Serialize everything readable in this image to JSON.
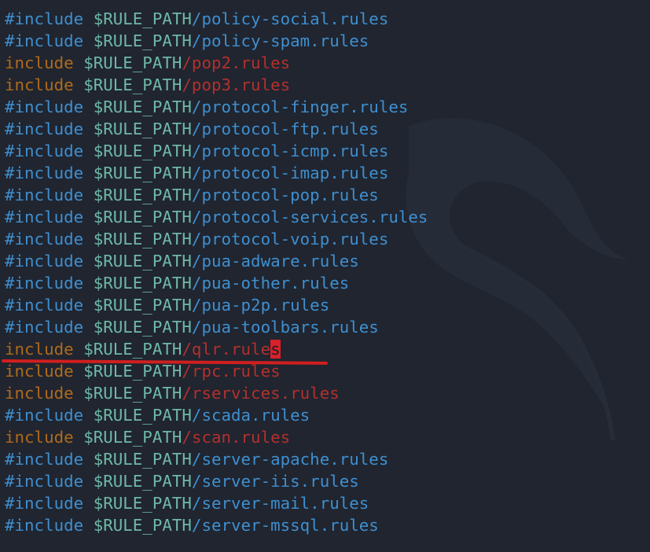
{
  "editor": {
    "lines": [
      {
        "prefix": "#include",
        "var": "$RULE_PATH",
        "path": "/policy-social.rules",
        "active": false
      },
      {
        "prefix": "#include",
        "var": "$RULE_PATH",
        "path": "/policy-spam.rules",
        "active": false
      },
      {
        "prefix": "include",
        "var": "$RULE_PATH",
        "path": "/pop2.rules",
        "active": true
      },
      {
        "prefix": "include",
        "var": "$RULE_PATH",
        "path": "/pop3.rules",
        "active": true
      },
      {
        "prefix": "#include",
        "var": "$RULE_PATH",
        "path": "/protocol-finger.rules",
        "active": false
      },
      {
        "prefix": "#include",
        "var": "$RULE_PATH",
        "path": "/protocol-ftp.rules",
        "active": false
      },
      {
        "prefix": "#include",
        "var": "$RULE_PATH",
        "path": "/protocol-icmp.rules",
        "active": false
      },
      {
        "prefix": "#include",
        "var": "$RULE_PATH",
        "path": "/protocol-imap.rules",
        "active": false
      },
      {
        "prefix": "#include",
        "var": "$RULE_PATH",
        "path": "/protocol-pop.rules",
        "active": false
      },
      {
        "prefix": "#include",
        "var": "$RULE_PATH",
        "path": "/protocol-services.rules",
        "active": false
      },
      {
        "prefix": "#include",
        "var": "$RULE_PATH",
        "path": "/protocol-voip.rules",
        "active": false
      },
      {
        "prefix": "#include",
        "var": "$RULE_PATH",
        "path": "/pua-adware.rules",
        "active": false
      },
      {
        "prefix": "#include",
        "var": "$RULE_PATH",
        "path": "/pua-other.rules",
        "active": false
      },
      {
        "prefix": "#include",
        "var": "$RULE_PATH",
        "path": "/pua-p2p.rules",
        "active": false
      },
      {
        "prefix": "#include",
        "var": "$RULE_PATH",
        "path": "/pua-toolbars.rules",
        "active": false
      },
      {
        "prefix": "include",
        "var": "$RULE_PATH",
        "path": "/qlr.rule",
        "cursor_char": "s",
        "active": true
      },
      {
        "prefix": "include",
        "var": "$RULE_PATH",
        "path": "/rpc.rules",
        "active": true
      },
      {
        "prefix": "include",
        "var": "$RULE_PATH",
        "path": "/rservices.rules",
        "active": true
      },
      {
        "prefix": "#include",
        "var": "$RULE_PATH",
        "path": "/scada.rules",
        "active": false
      },
      {
        "prefix": "include",
        "var": "$RULE_PATH",
        "path": "/scan.rules",
        "active": true
      },
      {
        "prefix": "#include",
        "var": "$RULE_PATH",
        "path": "/server-apache.rules",
        "active": false
      },
      {
        "prefix": "#include",
        "var": "$RULE_PATH",
        "path": "/server-iis.rules",
        "active": false
      },
      {
        "prefix": "#include",
        "var": "$RULE_PATH",
        "path": "/server-mail.rules",
        "active": false
      },
      {
        "prefix": "#include",
        "var": "$RULE_PATH",
        "path": "/server-mssql.rules",
        "active": false
      }
    ]
  },
  "colors": {
    "background": "#202530",
    "comment": "#3f8fcf",
    "include_keyword": "#b06a1a",
    "variable": "#6fb8a8",
    "active_path": "#b3302c",
    "cursor": "#d8212a",
    "annotation_underline": "#d01f1f"
  },
  "icons": {
    "watermark": "kali-dragon-icon"
  }
}
